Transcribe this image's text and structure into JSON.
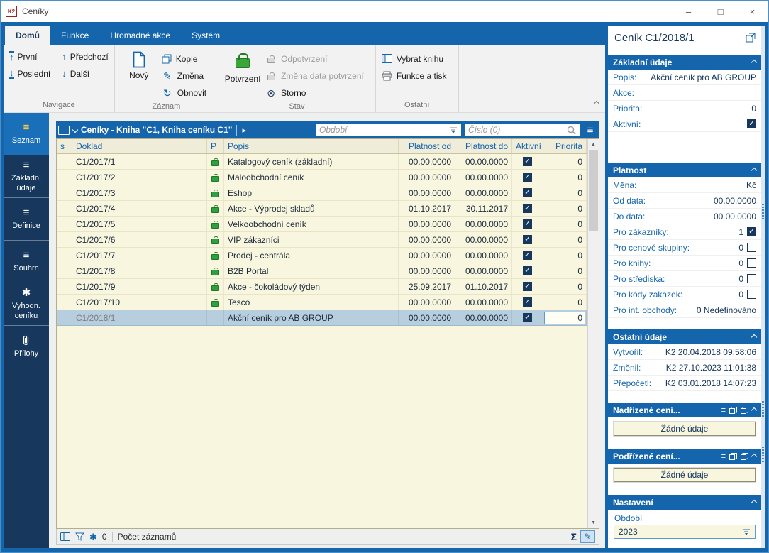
{
  "window": {
    "title": "Ceníky",
    "app_badge": "K2",
    "controls": {
      "minimize": "–",
      "maximize": "□",
      "close": "×"
    }
  },
  "icons": {
    "menu": "≡",
    "asterisk": "✱",
    "sum": "Σ",
    "pencil": "✎",
    "refresh": "↻",
    "storno": "⊗",
    "arrow_up": "↑",
    "arrow_down": "↓",
    "play": "▸",
    "scroll_up": "▲",
    "scroll_down": "▼"
  },
  "colors": {
    "accent": "#1565ac",
    "sidebar": "#17375c",
    "grid_bg": "#f8f6df",
    "selected_row": "#b7cedf",
    "lock_green": "#2f9e44"
  },
  "ribbon": {
    "tabs": [
      {
        "label": "Domů",
        "active": true
      },
      {
        "label": "Funkce",
        "active": false
      },
      {
        "label": "Hromadné akce",
        "active": false
      },
      {
        "label": "Systém",
        "active": false
      }
    ],
    "navigace": {
      "label": "Navigace",
      "first": "První",
      "last": "Poslední",
      "previous": "Předchozí",
      "next": "Další"
    },
    "zaznam": {
      "label": "Záznam",
      "new": "Nový",
      "copy": "Kopie",
      "change": "Změna",
      "refresh": "Obnovit"
    },
    "stav": {
      "label": "Stav",
      "confirm": "Potvrzení",
      "unconfirm": "Odpotvrzení",
      "change_date": "Změna data potvrzení",
      "cancel": "Storno"
    },
    "ostatni": {
      "label": "Ostatní",
      "select_book": "Vybrat knihu",
      "functions_print": "Funkce a tisk"
    }
  },
  "sidebar": {
    "items": [
      {
        "label": "Seznam",
        "active": true
      },
      {
        "label": "Základní údaje",
        "active": false
      },
      {
        "label": "Definice",
        "active": false
      },
      {
        "label": "Souhrn",
        "active": false
      },
      {
        "label": "Vyhodn. ceníku",
        "active": false
      },
      {
        "label": "Přílohy",
        "active": false
      }
    ]
  },
  "browse": {
    "title": "Ceníky - Kniha \"C1, Kniha ceníku C1\"",
    "period_placeholder": "Období",
    "number_placeholder": "Číslo (0)",
    "columns": {
      "s": "s",
      "doklad": "Doklad",
      "p": "P",
      "popis": "Popis",
      "od": "Platnost od",
      "do": "Platnost do",
      "aktivni": "Aktivní",
      "priorita": "Priorita"
    },
    "rows": [
      {
        "doklad": "C1/2017/1",
        "locked": true,
        "popis": "Katalogový ceník (základní)",
        "od": "00.00.0000",
        "do": "00.00.0000",
        "aktivni": true,
        "priorita": "0",
        "selected": false
      },
      {
        "doklad": "C1/2017/2",
        "locked": true,
        "popis": "Maloobchodní ceník",
        "od": "00.00.0000",
        "do": "00.00.0000",
        "aktivni": true,
        "priorita": "0",
        "selected": false
      },
      {
        "doklad": "C1/2017/3",
        "locked": true,
        "popis": "Eshop",
        "od": "00.00.0000",
        "do": "00.00.0000",
        "aktivni": true,
        "priorita": "0",
        "selected": false
      },
      {
        "doklad": "C1/2017/4",
        "locked": true,
        "popis": "Akce - Výprodej skladů",
        "od": "01.10.2017",
        "do": "30.11.2017",
        "aktivni": true,
        "priorita": "0",
        "selected": false
      },
      {
        "doklad": "C1/2017/5",
        "locked": true,
        "popis": "Velkoobchodní ceník",
        "od": "00.00.0000",
        "do": "00.00.0000",
        "aktivni": true,
        "priorita": "0",
        "selected": false
      },
      {
        "doklad": "C1/2017/6",
        "locked": true,
        "popis": "VIP zákazníci",
        "od": "00.00.0000",
        "do": "00.00.0000",
        "aktivni": true,
        "priorita": "0",
        "selected": false
      },
      {
        "doklad": "C1/2017/7",
        "locked": true,
        "popis": "Prodej - centrála",
        "od": "00.00.0000",
        "do": "00.00.0000",
        "aktivni": true,
        "priorita": "0",
        "selected": false
      },
      {
        "doklad": "C1/2017/8",
        "locked": true,
        "popis": "B2B Portal",
        "od": "00.00.0000",
        "do": "00.00.0000",
        "aktivni": true,
        "priorita": "0",
        "selected": false
      },
      {
        "doklad": "C1/2017/9",
        "locked": true,
        "popis": "Akce - čokoládový týden",
        "od": "25.09.2017",
        "do": "01.10.2017",
        "aktivni": true,
        "priorita": "0",
        "selected": false
      },
      {
        "doklad": "C1/2017/10",
        "locked": true,
        "popis": "Tesco",
        "od": "00.00.0000",
        "do": "00.00.0000",
        "aktivni": true,
        "priorita": "0",
        "selected": false
      },
      {
        "doklad": "C1/2018/1",
        "locked": false,
        "popis": "Akční ceník pro AB GROUP",
        "od": "00.00.0000",
        "do": "00.00.0000",
        "aktivni": true,
        "priorita": "0",
        "selected": true,
        "editing": true
      }
    ],
    "status": {
      "count": "0",
      "count_label": "Počet záznamů"
    }
  },
  "panel": {
    "title": "Ceník C1/2018/1",
    "sections": {
      "zakladni": {
        "title": "Základní údaje",
        "fields": [
          {
            "label": "Popis:",
            "value": "Akční ceník pro AB GROUP"
          },
          {
            "label": "Akce:",
            "value": ""
          },
          {
            "label": "Priorita:",
            "value": "0"
          },
          {
            "label": "Aktivní:",
            "value": "",
            "checked": true
          }
        ]
      },
      "platnost": {
        "title": "Platnost",
        "fields": [
          {
            "label": "Měna:",
            "value": "Kč"
          },
          {
            "label": "Od data:",
            "value": "00.00.0000"
          },
          {
            "label": "Do data:",
            "value": "00.00.0000"
          },
          {
            "label": "Pro zákazníky:",
            "value": "1",
            "checked": true
          },
          {
            "label": "Pro cenové skupiny:",
            "value": "0",
            "checked": false
          },
          {
            "label": "Pro knihy:",
            "value": "0",
            "checked": false
          },
          {
            "label": "Pro střediska:",
            "value": "0",
            "checked": false
          },
          {
            "label": "Pro kódy zakázek:",
            "value": "0",
            "checked": false
          },
          {
            "label": "Pro int. obchody:",
            "value": "0 Nedefinováno"
          }
        ]
      },
      "ostatni_udaje": {
        "title": "Ostatní údaje",
        "fields": [
          {
            "label": "Vytvořil:",
            "value": "K2 20.04.2018 09:58:06"
          },
          {
            "label": "Změnil:",
            "value": "K2 27.10.2023 11:01:38"
          },
          {
            "label": "Přepočetl:",
            "value": "K2 03.01.2018 14:07:23"
          }
        ]
      },
      "nadrizene": {
        "title": "Nadřízené cení...",
        "empty_label": "Žádné údaje"
      },
      "podrizene": {
        "title": "Podřízené cení...",
        "empty_label": "Žádné údaje"
      },
      "nastaveni": {
        "title": "Nastavení",
        "period_label": "Období",
        "period_value": "2023"
      }
    }
  }
}
